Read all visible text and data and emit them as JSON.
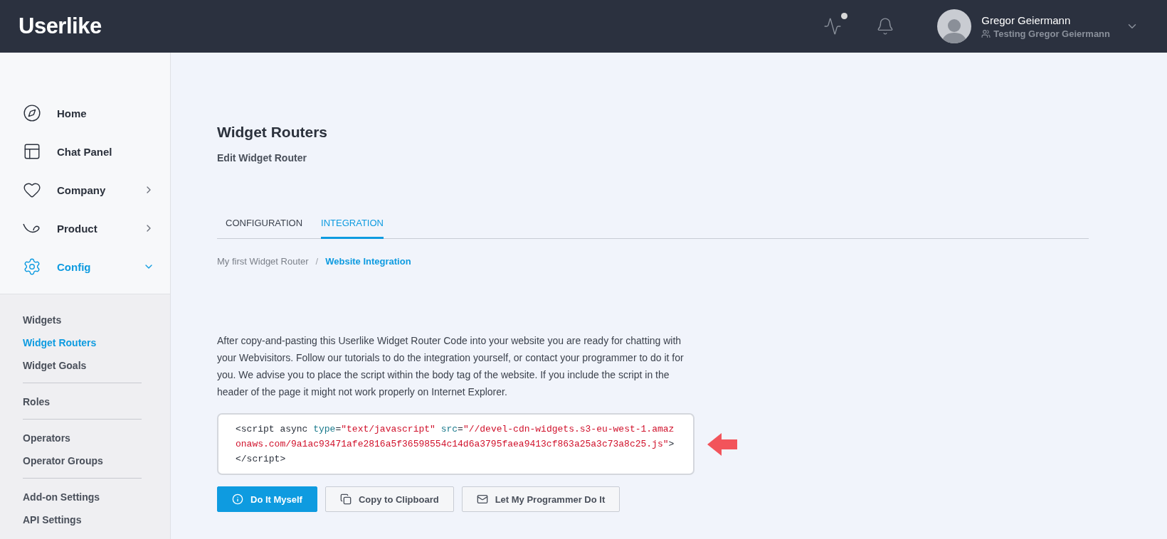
{
  "header": {
    "logo": "Userlike",
    "user": {
      "name": "Gregor Geiermann",
      "account": "Testing Gregor Geiermann"
    },
    "activity_unread": true
  },
  "sidebar": {
    "items": [
      {
        "label": "Home",
        "selected": false
      },
      {
        "label": "Chat Panel",
        "selected": false
      },
      {
        "label": "Company",
        "selected": false,
        "expanded": false
      },
      {
        "label": "Product",
        "selected": false,
        "expanded": false
      },
      {
        "label": "Config",
        "selected": true,
        "expanded": true
      }
    ],
    "subitems": [
      [
        {
          "label": "Widgets",
          "selected": false
        },
        {
          "label": "Widget Routers",
          "selected": true
        },
        {
          "label": "Widget Goals",
          "selected": false
        }
      ],
      [
        {
          "label": "Roles",
          "selected": false
        }
      ],
      [
        {
          "label": "Operators",
          "selected": false
        },
        {
          "label": "Operator Groups",
          "selected": false
        }
      ],
      [
        {
          "label": "Add-on Settings",
          "selected": false
        },
        {
          "label": "API Settings",
          "selected": false
        }
      ]
    ]
  },
  "page": {
    "title": "Widget Routers",
    "subtitle": "Edit Widget Router",
    "tabs": [
      {
        "label": "CONFIGURATION",
        "selected": false
      },
      {
        "label": "INTEGRATION",
        "selected": true
      }
    ],
    "breadcrumb_separator": "/",
    "breadcrumb": [
      {
        "label": "My first Widget Router",
        "selected": false
      },
      {
        "label": "Website Integration",
        "selected": true
      }
    ],
    "intro": "After copy-and-pasting this Userlike Widget Router Code into your website you are ready for chatting with your Webvisitors. Follow our tutorials to do the integration yourself, or contact your programmer to do it for you. We advise you to place the script within the body tag of the website. If you include the script in the header of the page it might not work properly on Internet Explorer.",
    "code": [
      {
        "kind": "tag",
        "text": "<script async "
      },
      {
        "kind": "attr",
        "text": "type"
      },
      {
        "kind": "punct",
        "text": "="
      },
      {
        "kind": "string",
        "text": "\"text/javascript\" "
      },
      {
        "kind": "attr",
        "text": "src"
      },
      {
        "kind": "punct",
        "text": "="
      },
      {
        "kind": "string",
        "text": "\"//devel-cdn-widgets.s3-eu-west-1.amazonaws.com/9a1ac93471afe2816a5f36598554c14d6a3795faea9413cf863a25a3c73a8c25.js\""
      },
      {
        "kind": "tag",
        "text": ">"
      },
      {
        "kind": "closing",
        "text": "</script>"
      }
    ],
    "buttons": [
      {
        "label": "Do It Myself",
        "primary": true
      },
      {
        "label": "Copy to Clipboard",
        "primary": false
      },
      {
        "label": "Let My Programmer Do It",
        "primary": false
      }
    ]
  }
}
